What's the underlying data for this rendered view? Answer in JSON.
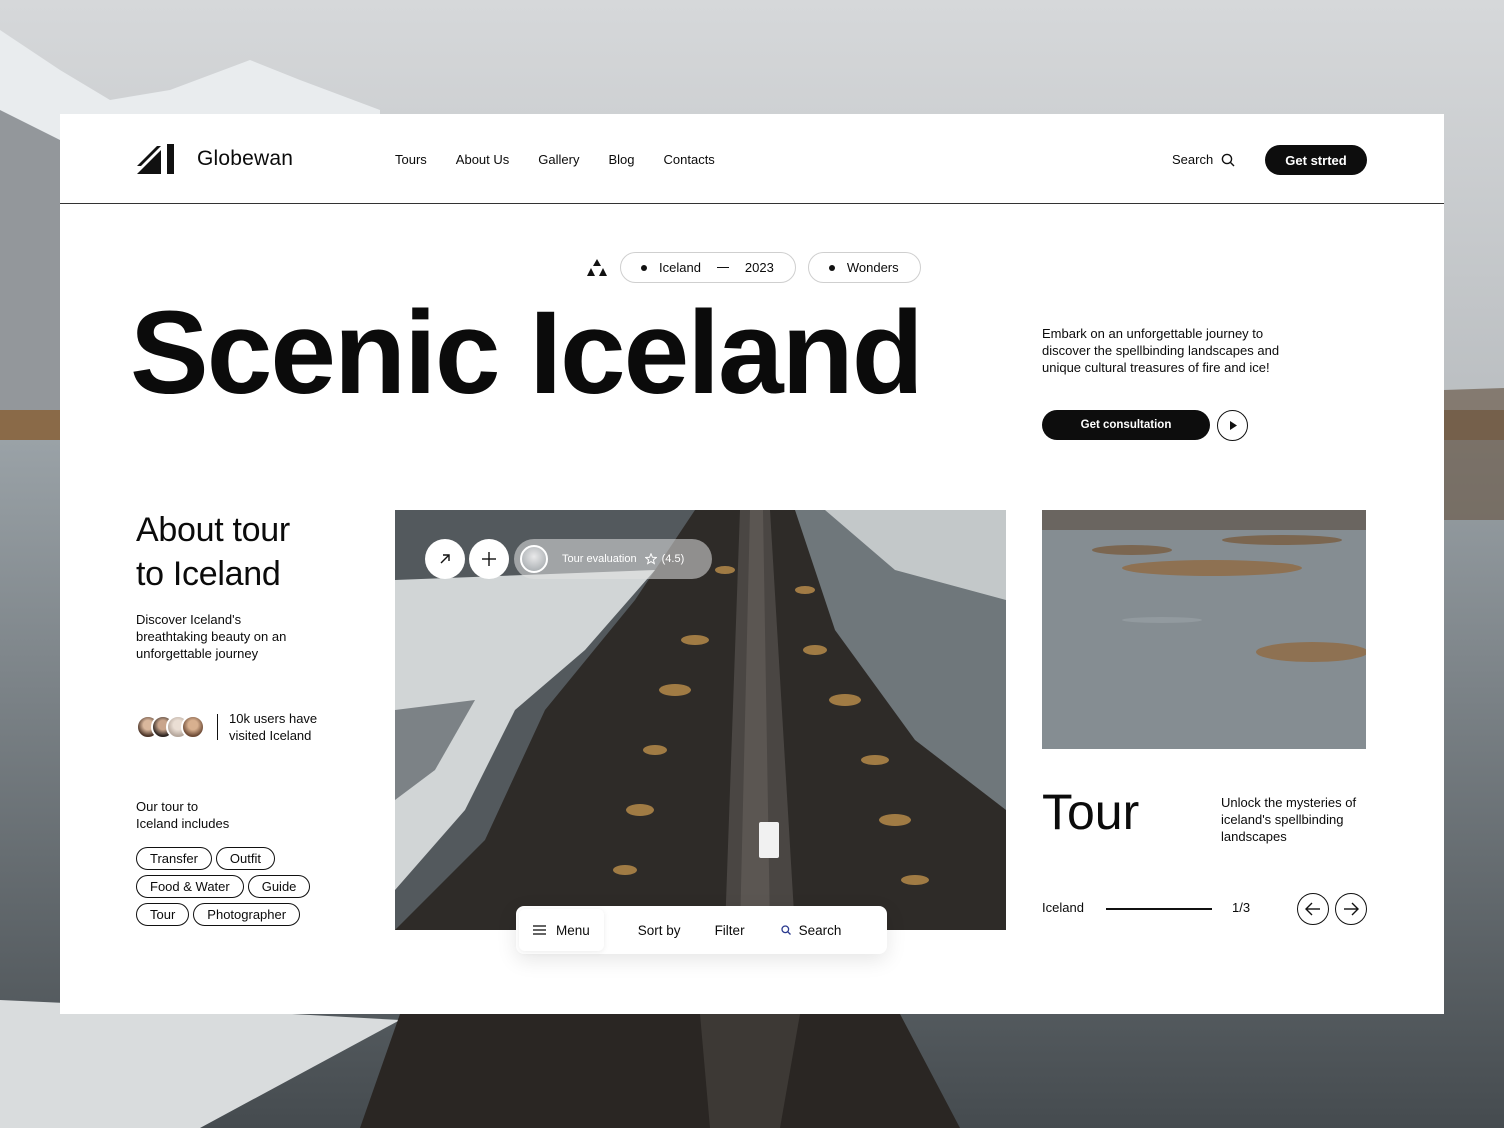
{
  "brand": {
    "name": "Globewan"
  },
  "nav": {
    "items": [
      "Tours",
      "About Us",
      "Gallery",
      "Blog",
      "Contacts"
    ],
    "search_label": "Search",
    "cta_label": "Get strted"
  },
  "tags": {
    "location": "Iceland",
    "year": "2023",
    "theme": "Wonders"
  },
  "hero": {
    "title": "Scenic Iceland",
    "description": "Embark on an unforgettable journey to discover the spellbinding landscapes and unique cultural treasures of fire and ice!",
    "consult_label": "Get consultation"
  },
  "about": {
    "title_line1": "About tour",
    "title_line2": "to Iceland",
    "description": "Discover Iceland's breathtaking beauty on an unforgettable journey",
    "users_line1": "10k users have",
    "users_line2": "visited Iceland",
    "includes_line1": "Our tour to",
    "includes_line2": "Iceland includes",
    "chips": [
      "Transfer",
      "Outfit",
      "Food & Water",
      "Guide",
      "Tour",
      "Photographer"
    ]
  },
  "evaluation": {
    "label": "Tour evaluation",
    "rating": "(4.5)"
  },
  "toolbar": {
    "menu": "Menu",
    "sort": "Sort by",
    "filter": "Filter",
    "search": "Search"
  },
  "tour": {
    "title": "Tour",
    "description": "Unlock the mysteries of iceland's spellbinding landscapes",
    "location": "Iceland",
    "counter": "1/3"
  },
  "colors": {
    "accent": "#0d0d0d",
    "card": "#ffffff"
  }
}
